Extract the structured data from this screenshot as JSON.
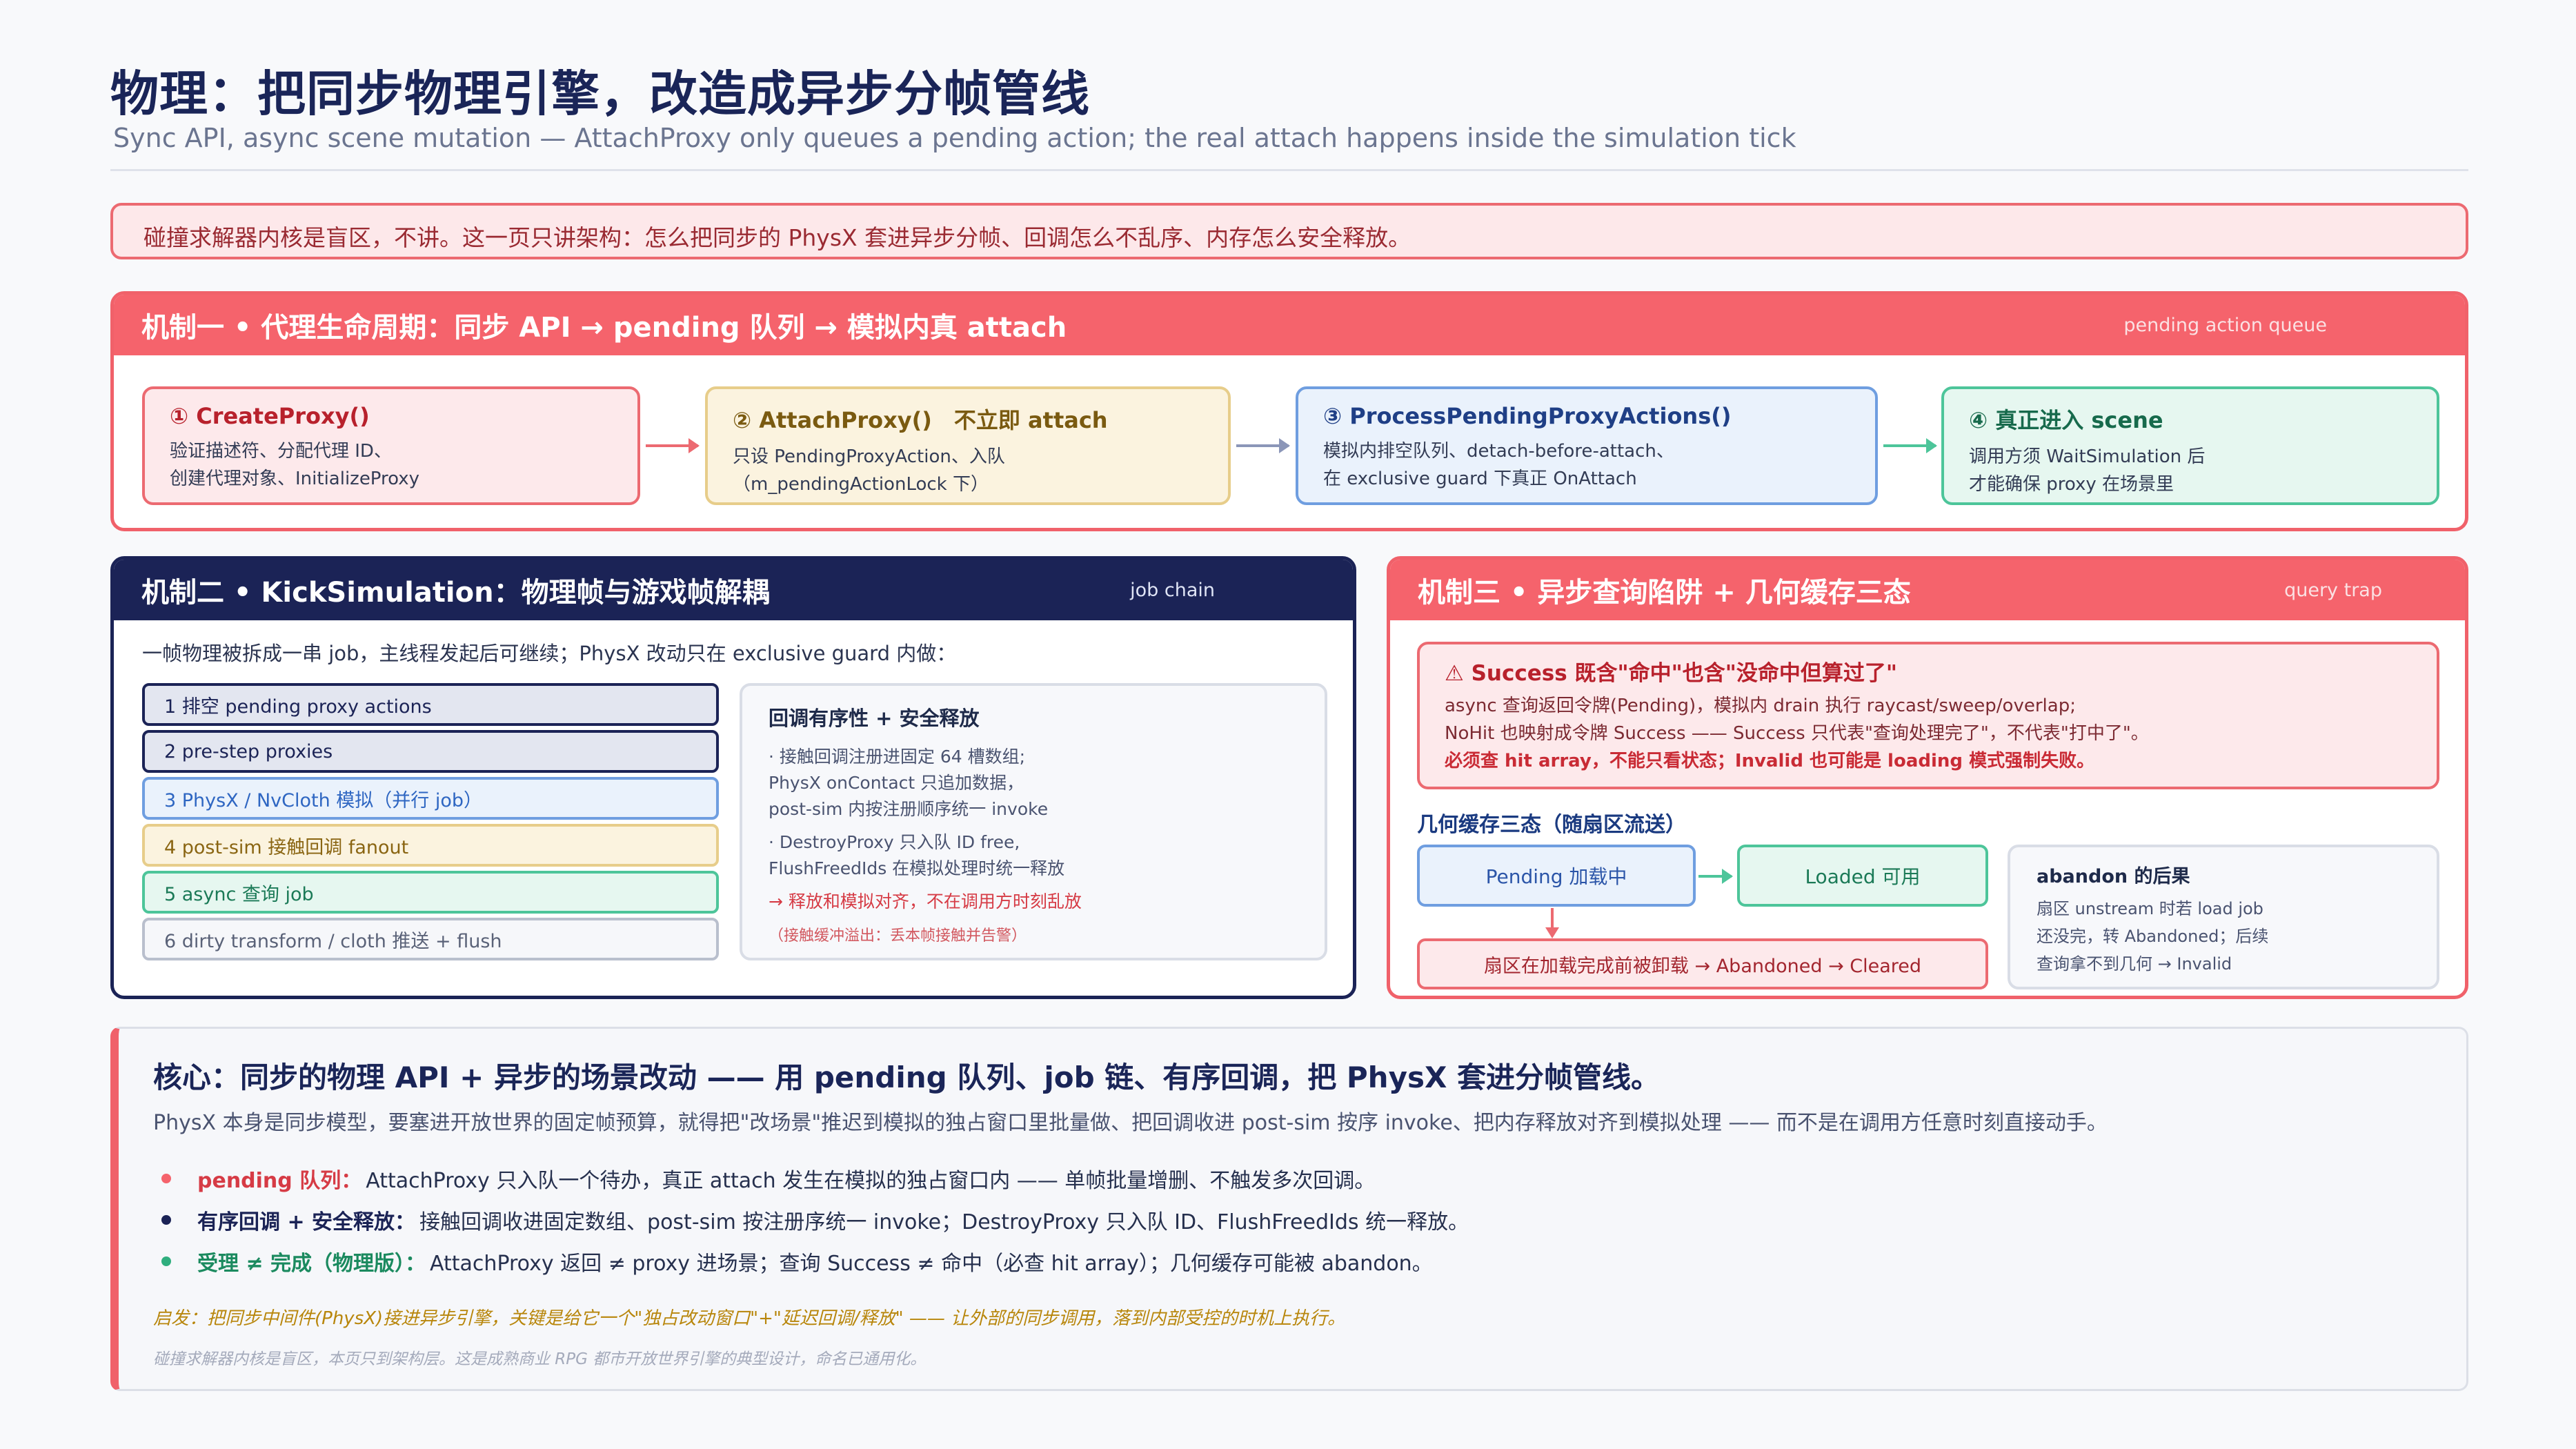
{
  "header": {
    "title": "物理：把同步物理引擎，改造成异步分帧管线",
    "subtitle": "Sync API, async scene mutation — AttachProxy only queues a pending action; the real attach happens inside the simulation tick"
  },
  "notice": "碰撞求解器内核是盲区，不讲。这一页只讲架构：怎么把同步的 PhysX 套进异步分帧、回调怎么不乱序、内存怎么安全释放。",
  "mech1": {
    "title": "机制一 • 代理生命周期：同步 API → pending 队列 → 模拟内真 attach",
    "tag": "pending action queue",
    "steps": [
      {
        "title": "① CreateProxy()",
        "line1": "验证描述符、分配代理 ID、",
        "line2": "创建代理对象、InitializeProxy"
      },
      {
        "title": "② AttachProxy()　不立即 attach",
        "line1": "只设 PendingProxyAction、入队",
        "line2": "（m_pendingActionLock 下）"
      },
      {
        "title": "③ ProcessPendingProxyActions()",
        "line1": "模拟内排空队列、detach-before-attach、",
        "line2": "在 exclusive guard 下真正 OnAttach"
      },
      {
        "title": "④ 真正进入 scene",
        "line1": "调用方须 WaitSimulation 后",
        "line2": "才能确保 proxy 在场景里"
      }
    ]
  },
  "mech2": {
    "title": "机制二 • KickSimulation：物理帧与游戏帧解耦",
    "tag": "job chain",
    "intro": "一帧物理被拆成一串 job，主线程发起后可继续；PhysX 改动只在 exclusive guard 内做：",
    "jobs": [
      "1 排空 pending proxy actions",
      "2 pre-step proxies",
      "3 PhysX / NvCloth 模拟（并行 job）",
      "4 post-sim 接触回调 fanout",
      "5 async 查询 job",
      "6 dirty transform / cloth 推送 + flush"
    ],
    "callback": {
      "title": "回调有序性 + 安全释放",
      "l1": "· 接触回调注册进固定 64 槽数组;",
      "l2": "PhysX onContact 只追加数据，",
      "l3": "post-sim 内按注册顺序统一 invoke",
      "l4": "· DestroyProxy 只入队 ID free,",
      "l5": "FlushFreedIds 在模拟处理时统一释放",
      "result": "→ 释放和模拟对齐，不在调用方时刻乱放",
      "note": "（接触缓冲溢出：丢本帧接触并告警）"
    }
  },
  "mech3": {
    "title": "机制三 • 异步查询陷阱 + 几何缓存三态",
    "tag": "query trap",
    "warn": {
      "title": "⚠ Success 既含\"命中\"也含\"没命中但算过了\"",
      "l1": "async 查询返回令牌(Pending)，模拟内 drain 执行 raycast/sweep/overlap;",
      "l2": "NoHit 也映射成令牌 Success —— Success 只代表\"查询处理完了\"，不代表\"打中了\"。",
      "l3": "必须查 hit array，不能只看状态；Invalid 也可能是 loading 模式强制失败。"
    },
    "cache_title": "几何缓存三态（随扇区流送）",
    "pending": "Pending 加载中",
    "loaded": "Loaded 可用",
    "abandoned": "扇区在加载完成前被卸载 → Abandoned → Cleared",
    "abandon": {
      "title": "abandon 的后果",
      "l1": "扇区 unstream 时若 load job",
      "l2": "还没完，转 Abandoned；后续",
      "l3": "查询拿不到几何 → Invalid"
    }
  },
  "core": {
    "title": "核心：同步的物理 API + 异步的场景改动 —— 用 pending 队列、job 链、有序回调，把 PhysX 套进分帧管线。",
    "intro": "PhysX 本身是同步模型，要塞进开放世界的固定帧预算，就得把\"改场景\"推迟到模拟的独占窗口里批量做、把回调收进 post-sim 按序 invoke、把内存释放对齐到模拟处理 —— 而不是在调用方任意时刻直接动手。",
    "bullets": [
      {
        "key": "pending 队列：",
        "text": "AttachProxy 只入队一个待办，真正 attach 发生在模拟的独占窗口内 —— 单帧批量增删、不触发多次回调。"
      },
      {
        "key": "有序回调 + 安全释放：",
        "text": "接触回调收进固定数组、post-sim 按注册序统一 invoke；DestroyProxy 只入队 ID、FlushFreedIds 统一释放。"
      },
      {
        "key": "受理 ≠ 完成（物理版）：",
        "text": "AttachProxy 返回 ≠ proxy 进场景；查询 Success ≠ 命中（必查 hit array）；几何缓存可能被 abandon。"
      }
    ],
    "inspiration": "启发：把同步中间件(PhysX)接进异步引擎，关键是给它一个\"独占改动窗口\"+\"延迟回调/释放\" —— 让外部的同步调用，落到内部受控的时机上执行。",
    "footnote": "碰撞求解器内核是盲区，本页只到架构层。这是成熟商业 RPG 都市开放世界引擎的典型设计，命名已通用化。"
  },
  "colors": {
    "red": "#f5636c",
    "navy": "#1b2356",
    "green": "#4dc59a",
    "blue": "#6f9ee0",
    "amber": "#e7cd8a"
  }
}
